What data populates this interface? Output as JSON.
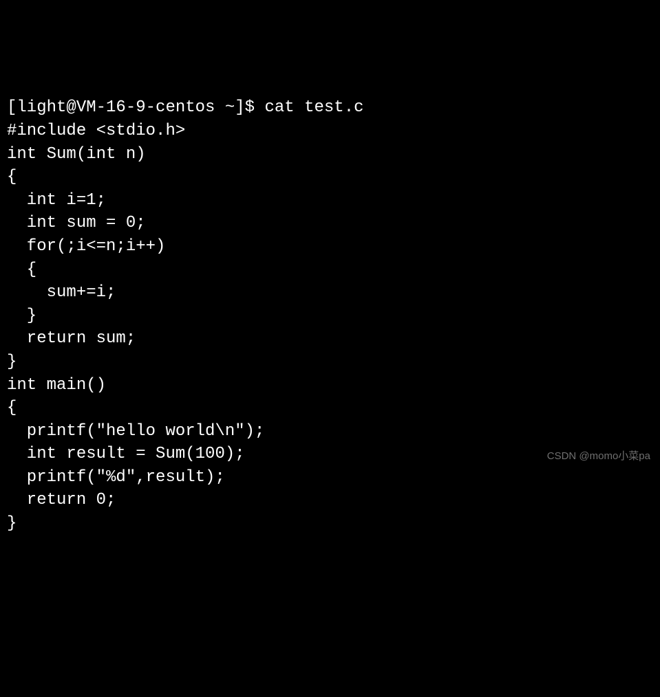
{
  "terminal": {
    "prompt": "[light@VM-16-9-centos ~]$ ",
    "command": "cat test.c",
    "lines": [
      "#include <stdio.h>",
      "",
      "int Sum(int n)",
      "{",
      "  int i=1;",
      "  int sum = 0;",
      "  for(;i<=n;i++)",
      "  {",
      "    sum+=i;",
      "  }",
      "  return sum;",
      "}",
      "int main()",
      "{",
      "  printf(\"hello world\\n\");",
      "  int result = Sum(100);",
      "  printf(\"%d\",result);",
      "  return 0;",
      "}"
    ]
  },
  "watermark": "CSDN @momo小菜pa"
}
